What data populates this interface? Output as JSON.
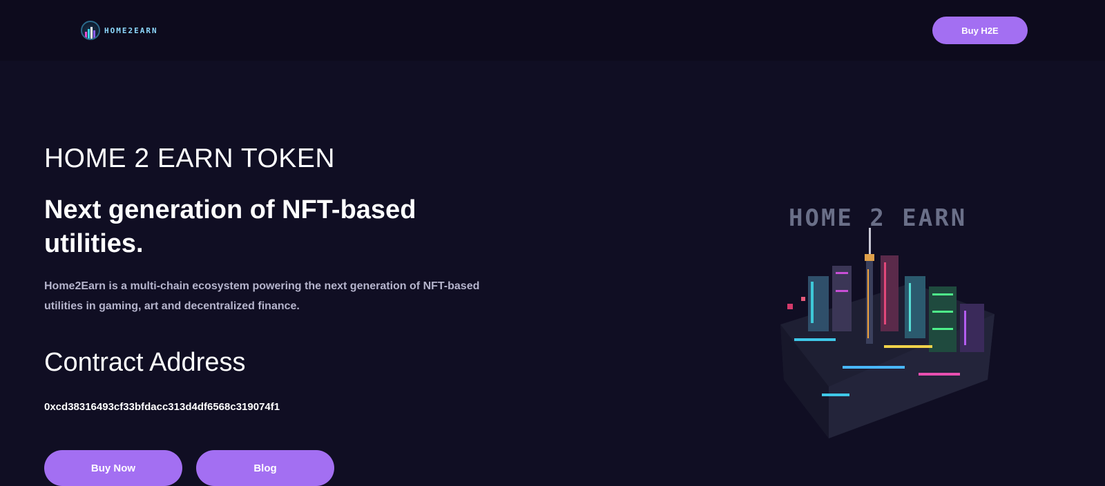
{
  "header": {
    "logo_text": "HOME2EARN",
    "buy_button": "Buy H2E"
  },
  "hero": {
    "token_title": "HOME 2 EARN TOKEN",
    "headline": "Next generation of NFT-based utilities.",
    "description": "Home2Earn is a multi-chain ecosystem powering the next generation of NFT-based utilities in gaming, art and decentralized finance.",
    "contract_heading": "Contract Address",
    "contract_address": "0xcd38316493cf33bfdacc313d4df6568c319074f1",
    "buy_now_button": "Buy Now",
    "blog_button": "Blog",
    "image_caption": "HOME 2 EARN"
  },
  "colors": {
    "background": "#100e23",
    "navbar": "#0d0b1d",
    "accent": "#a36ff2",
    "muted_text": "#b5b4cc"
  }
}
